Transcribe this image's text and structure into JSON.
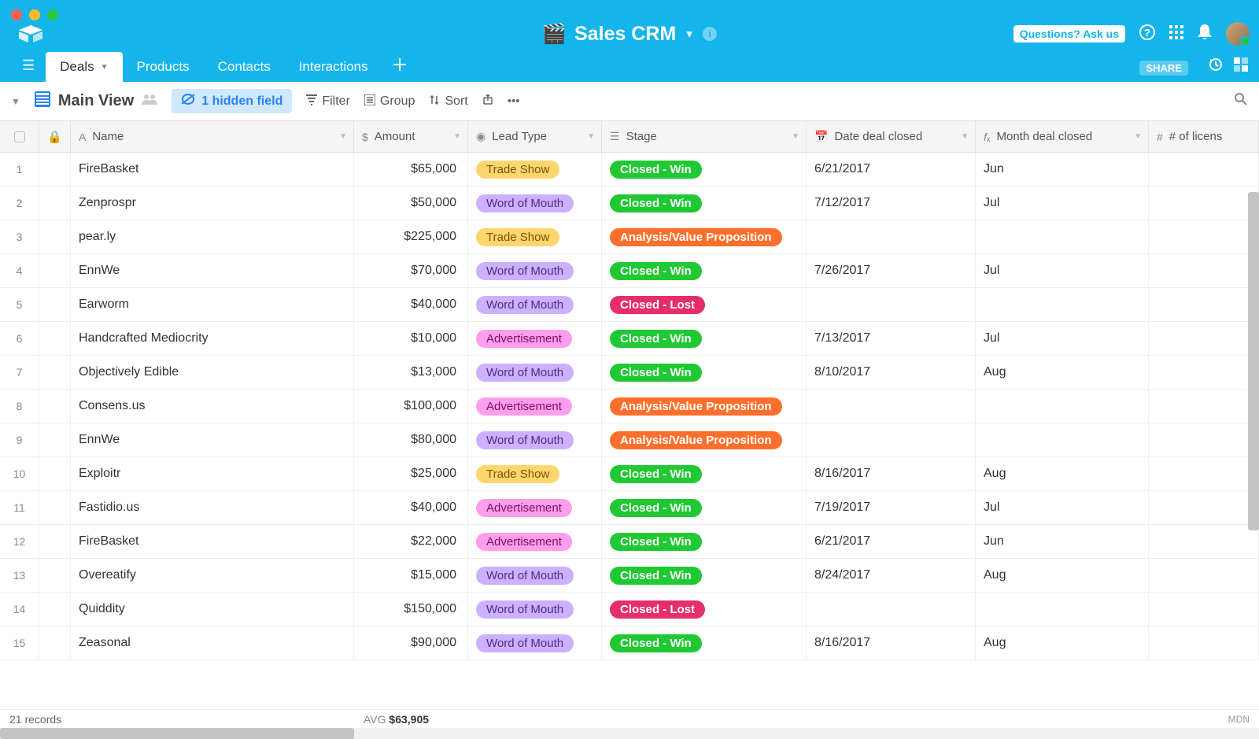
{
  "window": {
    "title": "Sales CRM"
  },
  "topbar": {
    "questions_btn": "Questions? Ask us"
  },
  "tabs": [
    {
      "label": "Deals",
      "active": true
    },
    {
      "label": "Products",
      "active": false
    },
    {
      "label": "Contacts",
      "active": false
    },
    {
      "label": "Interactions",
      "active": false
    }
  ],
  "share_label": "SHARE",
  "toolbar": {
    "view_name": "Main View",
    "hidden_field": "1 hidden field",
    "filter": "Filter",
    "group": "Group",
    "sort": "Sort"
  },
  "columns": {
    "name": "Name",
    "amount": "Amount",
    "lead": "Lead Type",
    "stage": "Stage",
    "date": "Date deal closed",
    "month": "Month deal closed",
    "licenses": "# of licens"
  },
  "lead_types": {
    "trade": "Trade Show",
    "word": "Word of Mouth",
    "ad": "Advertisement"
  },
  "stages": {
    "win": "Closed - Win",
    "lost": "Closed - Lost",
    "analysis": "Analysis/Value Proposition"
  },
  "rows": [
    {
      "name": "FireBasket",
      "amount": "$65,000",
      "lead": "trade",
      "stage": "win",
      "date": "6/21/2017",
      "month": "Jun"
    },
    {
      "name": "Zenprospr",
      "amount": "$50,000",
      "lead": "word",
      "stage": "win",
      "date": "7/12/2017",
      "month": "Jul"
    },
    {
      "name": "pear.ly",
      "amount": "$225,000",
      "lead": "trade",
      "stage": "analysis",
      "date": "",
      "month": ""
    },
    {
      "name": "EnnWe",
      "amount": "$70,000",
      "lead": "word",
      "stage": "win",
      "date": "7/26/2017",
      "month": "Jul"
    },
    {
      "name": "Earworm",
      "amount": "$40,000",
      "lead": "word",
      "stage": "lost",
      "date": "",
      "month": ""
    },
    {
      "name": "Handcrafted Mediocrity",
      "amount": "$10,000",
      "lead": "ad",
      "stage": "win",
      "date": "7/13/2017",
      "month": "Jul"
    },
    {
      "name": "Objectively Edible",
      "amount": "$13,000",
      "lead": "word",
      "stage": "win",
      "date": "8/10/2017",
      "month": "Aug"
    },
    {
      "name": "Consens.us",
      "amount": "$100,000",
      "lead": "ad",
      "stage": "analysis",
      "date": "",
      "month": ""
    },
    {
      "name": "EnnWe",
      "amount": "$80,000",
      "lead": "word",
      "stage": "analysis",
      "date": "",
      "month": ""
    },
    {
      "name": "Exploitr",
      "amount": "$25,000",
      "lead": "trade",
      "stage": "win",
      "date": "8/16/2017",
      "month": "Aug"
    },
    {
      "name": "Fastidio.us",
      "amount": "$40,000",
      "lead": "ad",
      "stage": "win",
      "date": "7/19/2017",
      "month": "Jul"
    },
    {
      "name": "FireBasket",
      "amount": "$22,000",
      "lead": "ad",
      "stage": "win",
      "date": "6/21/2017",
      "month": "Jun"
    },
    {
      "name": "Overeatify",
      "amount": "$15,000",
      "lead": "word",
      "stage": "win",
      "date": "8/24/2017",
      "month": "Aug"
    },
    {
      "name": "Quiddity",
      "amount": "$150,000",
      "lead": "word",
      "stage": "lost",
      "date": "",
      "month": ""
    },
    {
      "name": "Zeasonal",
      "amount": "$90,000",
      "lead": "word",
      "stage": "win",
      "date": "8/16/2017",
      "month": "Aug"
    }
  ],
  "footer": {
    "records": "21 records",
    "avg_label": "AVG",
    "avg_value": "$63,905",
    "brand": "MDN"
  }
}
